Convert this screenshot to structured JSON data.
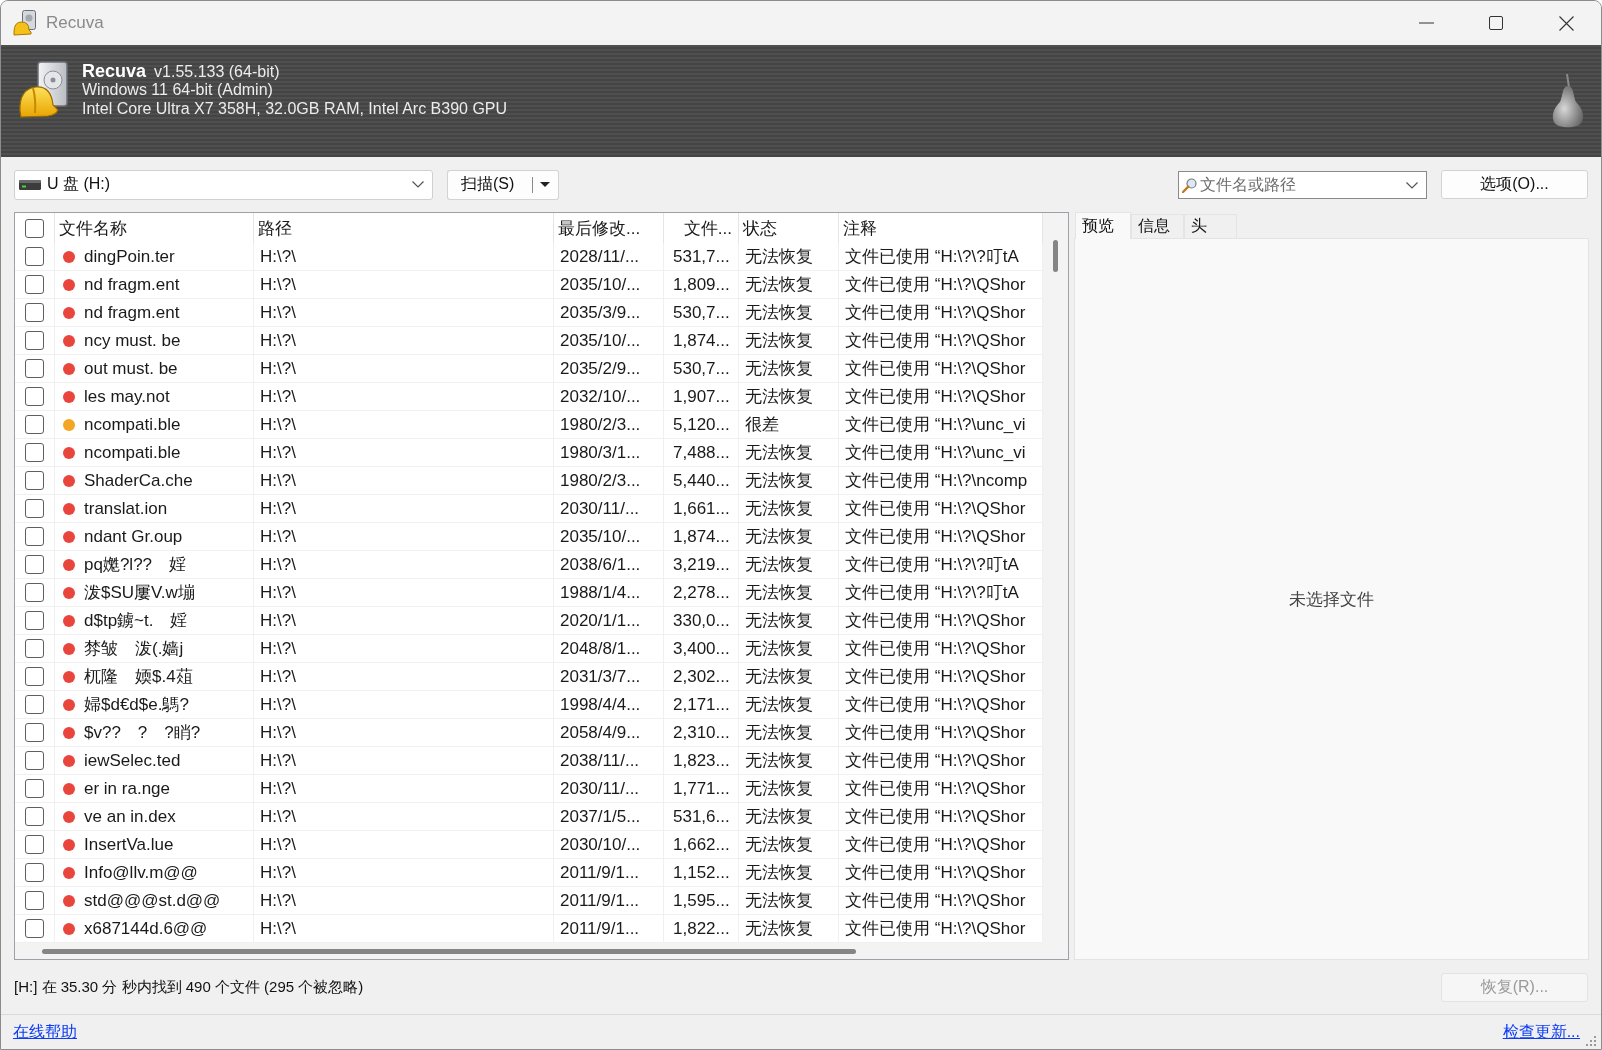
{
  "window": {
    "title": "Recuva"
  },
  "banner": {
    "app_name": "Recuva",
    "version": "v1.55.133 (64-bit)",
    "os": "Windows 11 64-bit (Admin)",
    "hardware": "Intel Core Ultra X7 358H, 32.0GB RAM, Intel Arc B390 GPU"
  },
  "toolbar": {
    "drive": "U 盘 (H:)",
    "scan_button": "扫描(S)",
    "search": {
      "placeholder": "文件名或路径"
    },
    "options_button": "选项(O)..."
  },
  "table": {
    "select_all": {
      "checked": false
    },
    "columns": [
      "文件名称",
      "路径",
      "最后修改...",
      "文件...",
      "状态",
      "注释"
    ],
    "rows": [
      {
        "checked": false,
        "color": "#e8453c",
        "name": "dingPoin.ter",
        "path": "H:\\?\\",
        "modified": "2028/11/...",
        "size": "531,7...",
        "state": "无法恢复",
        "comment": "文件已使用 “H:\\?\\?叮tA"
      },
      {
        "checked": false,
        "color": "#e8453c",
        "name": "nd fragm.ent",
        "path": "H:\\?\\",
        "modified": "2035/10/...",
        "size": "1,809...",
        "state": "无法恢复",
        "comment": "文件已使用 “H:\\?\\QShor"
      },
      {
        "checked": false,
        "color": "#e8453c",
        "name": "nd fragm.ent",
        "path": "H:\\?\\",
        "modified": "2035/3/9...",
        "size": "530,7...",
        "state": "无法恢复",
        "comment": "文件已使用 “H:\\?\\QShor"
      },
      {
        "checked": false,
        "color": "#e8453c",
        "name": "ncy must. be",
        "path": "H:\\?\\",
        "modified": "2035/10/...",
        "size": "1,874...",
        "state": "无法恢复",
        "comment": "文件已使用 “H:\\?\\QShor"
      },
      {
        "checked": false,
        "color": "#e8453c",
        "name": "out must. be",
        "path": "H:\\?\\",
        "modified": "2035/2/9...",
        "size": "530,7...",
        "state": "无法恢复",
        "comment": "文件已使用 “H:\\?\\QShor"
      },
      {
        "checked": false,
        "color": "#e8453c",
        "name": "les may.not",
        "path": "H:\\?\\",
        "modified": "2032/10/...",
        "size": "1,907...",
        "state": "无法恢复",
        "comment": "文件已使用 “H:\\?\\QShor"
      },
      {
        "checked": false,
        "color": "#f2a622",
        "name": "ncompati.ble",
        "path": "H:\\?\\",
        "modified": "1980/2/3...",
        "size": "5,120...",
        "state": "很差",
        "comment": "文件已使用 “H:\\?\\unc_vi"
      },
      {
        "checked": false,
        "color": "#e8453c",
        "name": "ncompati.ble",
        "path": "H:\\?\\",
        "modified": "1980/3/1...",
        "size": "7,488...",
        "state": "无法恢复",
        "comment": "文件已使用 “H:\\?\\unc_vi"
      },
      {
        "checked": false,
        "color": "#e8453c",
        "name": "ShaderCa.che",
        "path": "H:\\?\\",
        "modified": "1980/2/3...",
        "size": "5,440...",
        "state": "无法恢复",
        "comment": "文件已使用 “H:\\?\\ncomp"
      },
      {
        "checked": false,
        "color": "#e8453c",
        "name": "translat.ion",
        "path": "H:\\?\\",
        "modified": "2030/11/...",
        "size": "1,661...",
        "state": "无法恢复",
        "comment": "文件已使用 “H:\\?\\QShor"
      },
      {
        "checked": false,
        "color": "#e8453c",
        "name": "ndant Gr.oup",
        "path": "H:\\?\\",
        "modified": "2035/10/...",
        "size": "1,874...",
        "state": "无法恢复",
        "comment": "文件已使用 “H:\\?\\QShor"
      },
      {
        "checked": false,
        "color": "#e8453c",
        "name": "pq嬔?l??　婬",
        "path": "H:\\?\\",
        "modified": "2038/6/1...",
        "size": "3,219...",
        "state": "无法恢复",
        "comment": "文件已使用 “H:\\?\\?叮tA"
      },
      {
        "checked": false,
        "color": "#e8453c",
        "name": "泼$SU屢V.w塴",
        "path": "H:\\?\\",
        "modified": "1988/1/4...",
        "size": "2,278...",
        "state": "无法恢复",
        "comment": "文件已使用 “H:\\?\\?叮tA"
      },
      {
        "checked": false,
        "color": "#e8453c",
        "name": "d$tp鐪~t.　婬",
        "path": "H:\\?\\",
        "modified": "2020/1/1...",
        "size": "330,0...",
        "state": "无法恢复",
        "comment": "文件已使用 “H:\\?\\QShor"
      },
      {
        "checked": false,
        "color": "#e8453c",
        "name": "棼皱　泼(.嫱j",
        "path": "H:\\?\\",
        "modified": "2048/8/1...",
        "size": "3,400...",
        "state": "无法恢复",
        "comment": "文件已使用 “H:\\?\\QShor"
      },
      {
        "checked": false,
        "color": "#e8453c",
        "name": "杌隆　媆$.4葅",
        "path": "H:\\?\\",
        "modified": "2031/3/7...",
        "size": "2,302...",
        "state": "无法恢复",
        "comment": "文件已使用 “H:\\?\\QShor"
      },
      {
        "checked": false,
        "color": "#e8453c",
        "name": "婦$d€d$e.鷌?",
        "path": "H:\\?\\",
        "modified": "1998/4/4...",
        "size": "2,171...",
        "state": "无法恢复",
        "comment": "文件已使用 “H:\\?\\QShor"
      },
      {
        "checked": false,
        "color": "#e8453c",
        "name": "$v??　?　?睄?",
        "path": "H:\\?\\",
        "modified": "2058/4/9...",
        "size": "2,310...",
        "state": "无法恢复",
        "comment": "文件已使用 “H:\\?\\QShor"
      },
      {
        "checked": false,
        "color": "#e8453c",
        "name": "iewSelec.ted",
        "path": "H:\\?\\",
        "modified": "2038/11/...",
        "size": "1,823...",
        "state": "无法恢复",
        "comment": "文件已使用 “H:\\?\\QShor"
      },
      {
        "checked": false,
        "color": "#e8453c",
        "name": "er in ra.nge",
        "path": "H:\\?\\",
        "modified": "2030/11/...",
        "size": "1,771...",
        "state": "无法恢复",
        "comment": "文件已使用 “H:\\?\\QShor"
      },
      {
        "checked": false,
        "color": "#e8453c",
        "name": "ve an in.dex",
        "path": "H:\\?\\",
        "modified": "2037/1/5...",
        "size": "531,6...",
        "state": "无法恢复",
        "comment": "文件已使用 “H:\\?\\QShor"
      },
      {
        "checked": false,
        "color": "#e8453c",
        "name": "InsertVa.lue",
        "path": "H:\\?\\",
        "modified": "2030/10/...",
        "size": "1,662...",
        "state": "无法恢复",
        "comment": "文件已使用 “H:\\?\\QShor"
      },
      {
        "checked": false,
        "color": "#e8453c",
        "name": "Info@llv.m@@",
        "path": "H:\\?\\",
        "modified": "2011/9/1...",
        "size": "1,152...",
        "state": "无法恢复",
        "comment": "文件已使用 “H:\\?\\QShor"
      },
      {
        "checked": false,
        "color": "#e8453c",
        "name": "std@@@st.d@@",
        "path": "H:\\?\\",
        "modified": "2011/9/1...",
        "size": "1,595...",
        "state": "无法恢复",
        "comment": "文件已使用 “H:\\?\\QShor"
      },
      {
        "checked": false,
        "color": "#e8453c",
        "name": "x687144d.6@@",
        "path": "H:\\?\\",
        "modified": "2011/9/1...",
        "size": "1,822...",
        "state": "无法恢复",
        "comment": "文件已使用 “H:\\?\\QShor"
      }
    ]
  },
  "preview": {
    "tabs": [
      {
        "label": "预览",
        "selected": true
      },
      {
        "label": "信息",
        "selected": false
      },
      {
        "label": "头",
        "selected": false
      }
    ],
    "message": "未选择文件"
  },
  "status_bar": {
    "text": "[H:] 在 35.30 分 秒内找到 490 个文件 (295 个被忽略)",
    "recover_button": {
      "label": "恢复(R)...",
      "disabled": true
    }
  },
  "footer": {
    "help_link": "在线帮助",
    "update_link": "检查更新..."
  }
}
